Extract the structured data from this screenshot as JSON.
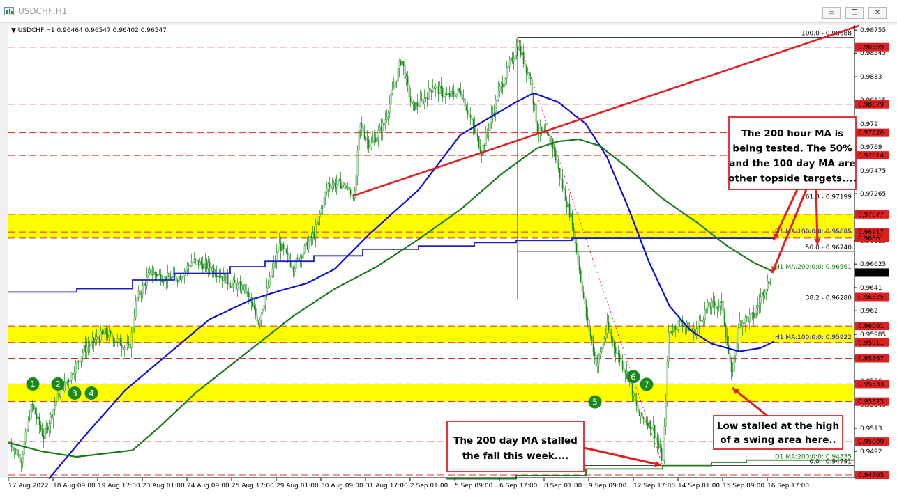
{
  "window": {
    "title": "USDCHF,H1",
    "buttons": {
      "minimize": "▭",
      "restore": "❐",
      "close": "✕"
    }
  },
  "chart_data": {
    "type": "line",
    "symbol_info": "USDCHF,H1  0.96464 0.96547 0.96402 0.96547",
    "ylim": [
      0.9468,
      0.988
    ],
    "grid": false,
    "y_ticks": [
      0.98755,
      0.98545,
      0.9833,
      0.98115,
      0.979,
      0.9769,
      0.97475,
      0.97265,
      0.9705,
      0.96835,
      0.96625,
      0.9641,
      0.962,
      0.95985,
      0.9577,
      0.9556,
      0.95345,
      0.9513,
      0.9492
    ],
    "x_ticks": [
      "17 Aug 2022",
      "18 Aug 09:00",
      "19 Aug 17:00",
      "23 Aug 01:00",
      "24 Aug 09:00",
      "25 Aug 17:00",
      "29 Aug 01:00",
      "30 Aug 09:00",
      "31 Aug 17:00",
      "2 Sep 01:00",
      "5 Sep 09:00",
      "6 Sep 17:00",
      "8 Sep 01:00",
      "9 Sep 09:00",
      "12 Sep 17:00",
      "14 Sep 01:00",
      "15 Sep 09:00",
      "16 Sep 17:00"
    ],
    "price_levels": [
      {
        "value": "0.98599",
        "v": 0.98599
      },
      {
        "value": "0.98079",
        "v": 0.98079
      },
      {
        "value": "0.97820",
        "v": 0.9782
      },
      {
        "value": "0.97614",
        "v": 0.97614
      },
      {
        "value": "0.97077",
        "v": 0.97077
      },
      {
        "value": "0.96917",
        "v": 0.96917
      },
      {
        "value": "0.96861",
        "v": 0.96861
      },
      {
        "value": "0.96325",
        "v": 0.96325
      },
      {
        "value": "0.96061",
        "v": 0.96061
      },
      {
        "value": "0.95911",
        "v": 0.95911
      },
      {
        "value": "0.95767",
        "v": 0.95767
      },
      {
        "value": "0.95533",
        "v": 0.95533
      },
      {
        "value": "0.95373",
        "v": 0.95373
      },
      {
        "value": "0.95009",
        "v": 0.95009
      },
      {
        "value": "0.94705",
        "v": 0.94705
      }
    ],
    "current_price": "0.96547",
    "current_price_v": 0.96547,
    "yellow_zones": [
      [
        0.96861,
        0.97077
      ],
      [
        0.95911,
        0.96061
      ],
      [
        0.95373,
        0.95533
      ]
    ],
    "fibonacci": [
      {
        "label": "100.0 - 0.98688",
        "v": 0.98688
      },
      {
        "label": "61.8 - 0.97199",
        "v": 0.97199
      },
      {
        "label": "50.0 - 0.96740",
        "v": 0.9674
      },
      {
        "label": "38.2 - 0.96280",
        "v": 0.9628
      },
      {
        "label": "0.0 - 0.94791",
        "v": 0.94791
      }
    ],
    "ma_labels": [
      {
        "label": "D1 MA:100:0:0: 0.95885",
        "v": 0.96885
      },
      {
        "label": "H1 MA:200:0:0: 0.96561",
        "v": 0.96561
      },
      {
        "label": "H1 MA:100:0:0: 0.95922",
        "v": 0.95922
      },
      {
        "label": "D1 MA:200:0:0: 0.94835",
        "v": 0.94835
      }
    ],
    "series": [
      {
        "name": "H1 MA:100",
        "color": "#1010d0"
      },
      {
        "name": "H1 MA:200",
        "color": "#1a7a1a"
      },
      {
        "name": "D1 MA:100",
        "color": "#2020c0"
      },
      {
        "name": "D1 MA:200",
        "color": "#1a7a1a"
      }
    ],
    "markers": [
      "1",
      "2",
      "3",
      "4",
      "5",
      "6",
      "7"
    ],
    "annotations": {
      "top_right": [
        "The 200 hour MA is",
        "being tested. The 50%",
        "and the 100 day MA are",
        "other topside targets...."
      ],
      "low_right": [
        "Low stalled at the high",
        "of a swing area here.."
      ],
      "bottom_mid": [
        "The 200 day MA stalled",
        "the fall this week...."
      ]
    },
    "colors": {
      "candle_up": "#1a8a1a",
      "candle_down": "#1a8a1a",
      "trend": "#e02020",
      "annotation_border": "#e02020",
      "zone": "#ffff00",
      "level_box": "#e02020"
    }
  }
}
